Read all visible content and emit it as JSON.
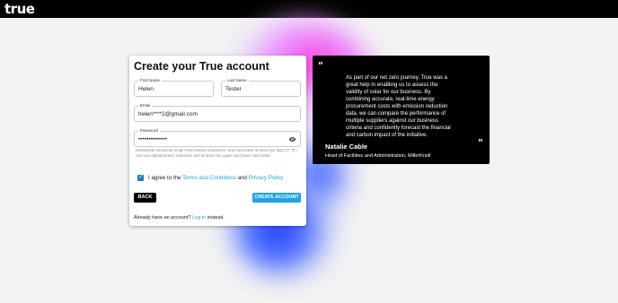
{
  "header": {
    "logo": "true"
  },
  "form": {
    "title": "Create your True account",
    "first_name": {
      "label": "First Name",
      "value": "Helen"
    },
    "last_name": {
      "label": "Last Name",
      "value": "Tester"
    },
    "email": {
      "label": "Email",
      "value": "helen****2@gmail.com"
    },
    "password": {
      "label": "Password",
      "value": "••••••••••••••"
    },
    "password_hint": "Passwords should be longer than twelve characters, and must have at least one digit ('0'-'9'), one non-alphanumeric character and at least one upper and lower case letter.",
    "agree_prefix": "I agree to the",
    "terms_link": "Terms and Conditions",
    "agree_and": "and",
    "privacy_link": "Privacy Policy",
    "agree_checked": true,
    "back_button": "BACK",
    "create_button": "CREATE ACCOUNT",
    "footer_prefix": "Already have an account?",
    "login_link": "Log in",
    "footer_suffix": "instead."
  },
  "testimonial": {
    "open_quote": "\"",
    "close_quote": "\"",
    "text": "As part of our net zero journey, True was a great help in enabling us to assess the validity of solar for our business. By combining accurate, real-time energy procurement costs with emission reduction data, we can compare the performance of multiple suppliers against our business criteria and confidently forecast the financial and carbon impact of the initiative.",
    "name": "Natalie Cable",
    "role": "Head of Facilities and Administration, MillerKnoll"
  },
  "colors": {
    "accent": "#1fa3e3",
    "link": "#1fa3d8",
    "background": "#f3f3f3",
    "quote_bg": "#000000"
  }
}
